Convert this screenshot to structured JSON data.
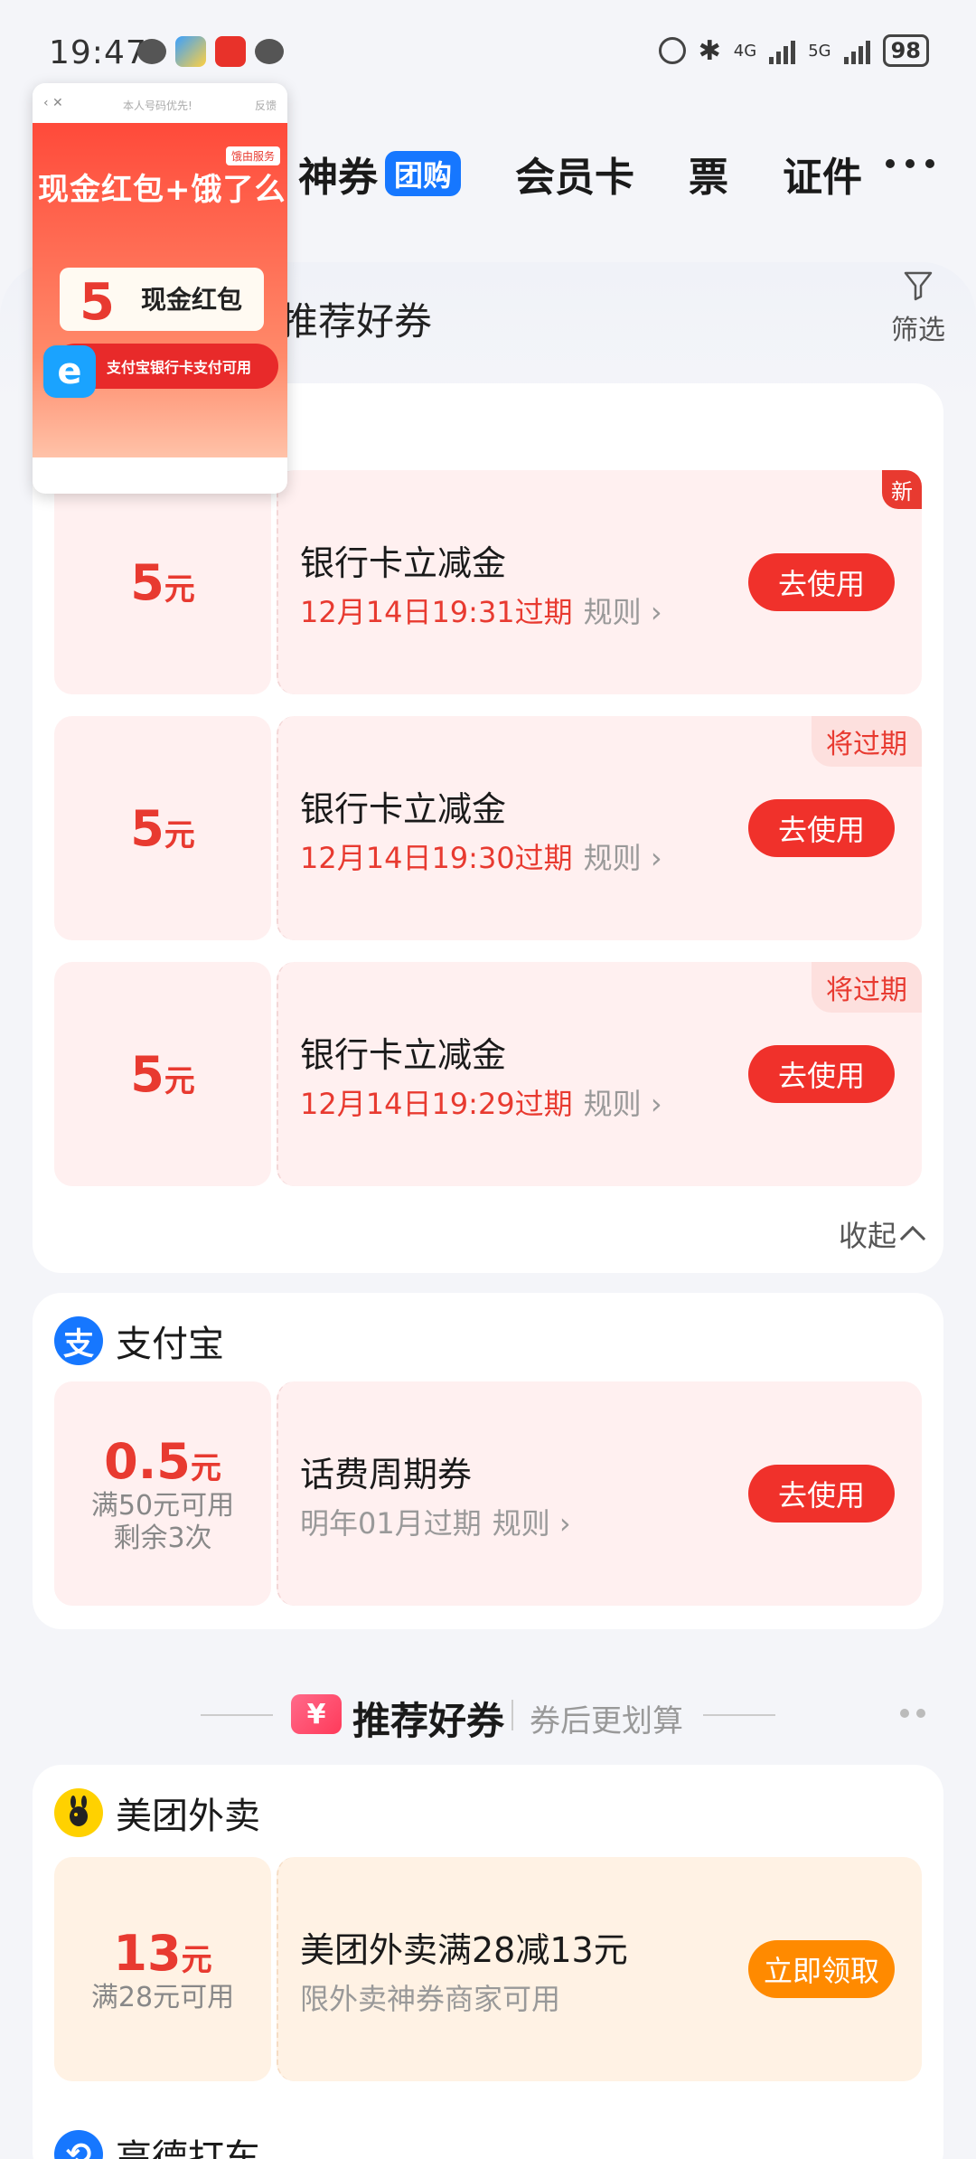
{
  "status_bar": {
    "time": "19:47",
    "network_4g": "4G",
    "network_5g": "5G",
    "battery": "98"
  },
  "nav": {
    "items": [
      {
        "label": "神券",
        "tag": "团购"
      },
      {
        "label": "会员卡"
      },
      {
        "label": "票"
      },
      {
        "label": "证件"
      }
    ]
  },
  "subtabs": {
    "active": "推荐好券",
    "filter_label": "筛选"
  },
  "group1": {
    "coupons": [
      {
        "amount": "5",
        "unit": "元",
        "title": "银行卡立减金",
        "expiry": "12月14日19:31过期",
        "rule": "规则",
        "button": "去使用",
        "badge": "新"
      },
      {
        "amount": "5",
        "unit": "元",
        "title": "银行卡立减金",
        "expiry": "12月14日19:30过期",
        "rule": "规则",
        "button": "去使用",
        "badge": "将过期"
      },
      {
        "amount": "5",
        "unit": "元",
        "title": "银行卡立减金",
        "expiry": "12月14日19:29过期",
        "rule": "规则",
        "button": "去使用",
        "badge": "将过期"
      }
    ],
    "collapse": "收起"
  },
  "alipay": {
    "name": "支付宝",
    "logo_char": "支",
    "coupon": {
      "amount": "0.5",
      "unit": "元",
      "cond1": "满50元可用",
      "cond2": "剩余3次",
      "title": "话费周期券",
      "expiry": "明年01月过期",
      "rule": "规则",
      "button": "去使用"
    }
  },
  "recommend": {
    "title": "推荐好券",
    "subtitle": "券后更划算",
    "icon_char": "¥"
  },
  "meituan": {
    "name": "美团外卖",
    "coupon": {
      "amount": "13",
      "unit": "元",
      "cond": "满28元可用",
      "title": "美团外卖满28减13元",
      "desc": "限外卖神券商家可用",
      "button": "立即领取"
    }
  },
  "next_section": {
    "name": "高德打车"
  },
  "ad": {
    "top_text": "本人号码优先!",
    "feedback": "反馈",
    "headline": "现金红包+饿了么",
    "tag": "饿由服务",
    "amount": "5",
    "cash_label": "现金红包",
    "button": "支付宝银行卡支付可用"
  },
  "colors": {
    "accent": "#f0312b",
    "alipay_blue": "#1677ff",
    "orange": "#ff8a00"
  }
}
